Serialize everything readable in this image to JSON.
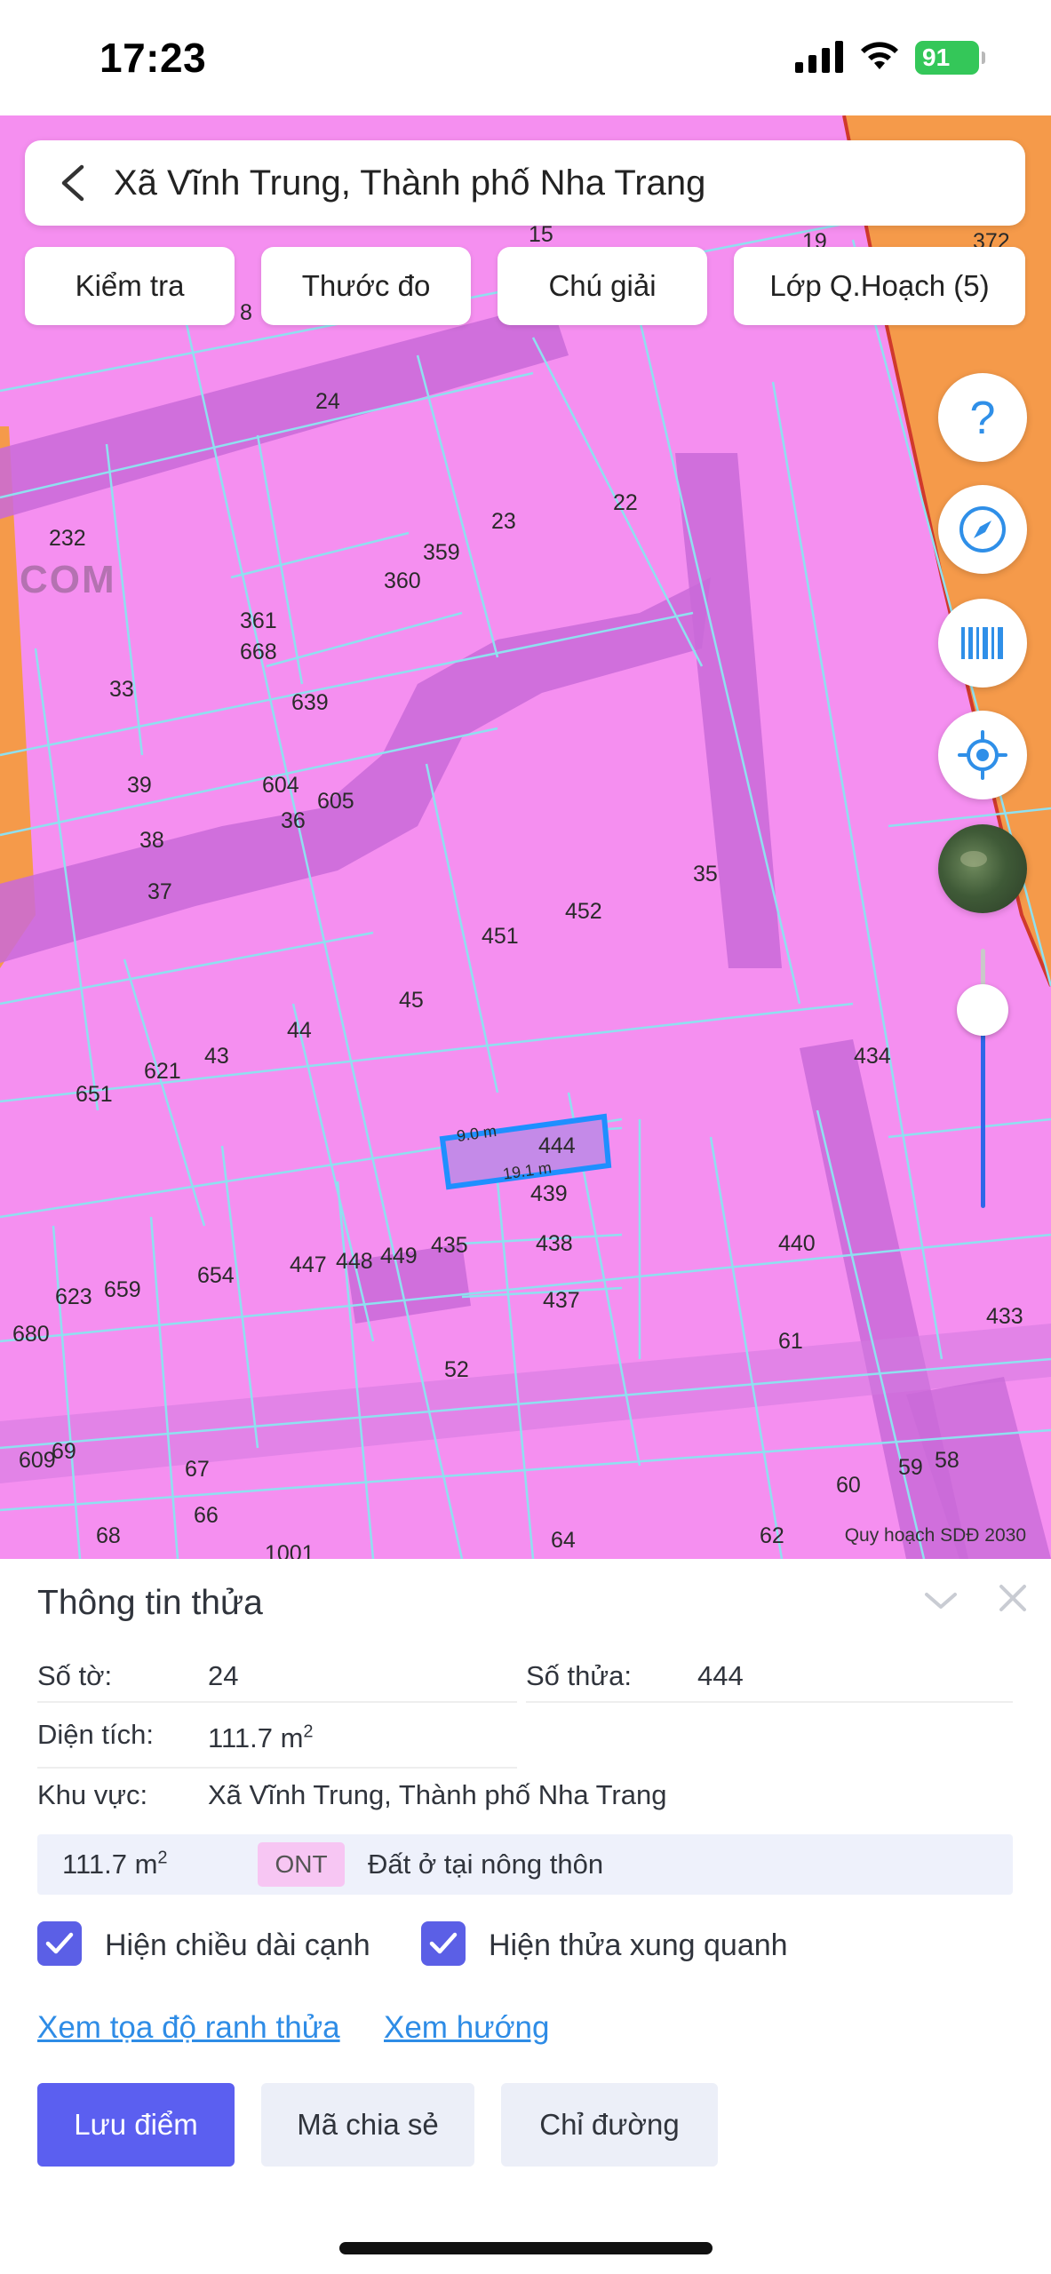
{
  "status_bar": {
    "time": "17:23",
    "battery": "91"
  },
  "location_bar": {
    "title": "Xã Vĩnh Trung, Thành phố Nha Trang"
  },
  "toolbar": {
    "check": "Kiểm tra",
    "measure": "Thước đo",
    "legend": "Chú giải",
    "layers": "Lớp Q.Hoạch (5)"
  },
  "map": {
    "watermark": "COM",
    "caption": "Quy hoạch SDĐ 2030",
    "selected_parcel": {
      "number": "444",
      "edge_short": "9.0 m",
      "edge_long": "19.1 m"
    },
    "parcel_labels": [
      "372",
      "19",
      "15",
      "8",
      "24",
      "22",
      "23",
      "359",
      "360",
      "232",
      "361",
      "668",
      "33",
      "639",
      "39",
      "604",
      "605",
      "36",
      "38",
      "37",
      "35",
      "452",
      "451",
      "45",
      "44",
      "43",
      "621",
      "651",
      "434",
      "439",
      "438",
      "440",
      "654",
      "447",
      "448",
      "449",
      "435",
      "623",
      "659",
      "680",
      "437",
      "433",
      "61",
      "52",
      "609",
      "69",
      "67",
      "66",
      "68",
      "1001",
      "64",
      "62",
      "60",
      "59",
      "58"
    ]
  },
  "panel": {
    "title": "Thông tin thửa",
    "sheet_label": "Số tờ:",
    "sheet_value": "24",
    "parcel_label": "Số thửa:",
    "parcel_value": "444",
    "area_label": "Diện tích:",
    "area_value": "111.7 m",
    "area_unit_exp": "2",
    "region_label": "Khu vực:",
    "region_value": "Xã Vĩnh Trung, Thành phố Nha Trang",
    "landuse": {
      "area": "111.7 m",
      "area_exp": "2",
      "code": "ONT",
      "name": "Đất ở tại nông thôn"
    },
    "check_edges": "Hiện chiều dài cạnh",
    "check_neighbors": "Hiện thửa xung quanh",
    "link_coords": "Xem tọa độ ranh thửa",
    "link_direction": "Xem hướng",
    "btn_save": "Lưu điểm",
    "btn_share": "Mã chia sẻ",
    "btn_route": "Chỉ đường"
  },
  "colors": {
    "map_land": "#f58ff0",
    "parcel_line": "#8fe0f0",
    "road": "#c96ad8",
    "orange_zone": "#f59a4a",
    "accent": "#5b5ff0",
    "selected_outline": "#1f8fff"
  }
}
